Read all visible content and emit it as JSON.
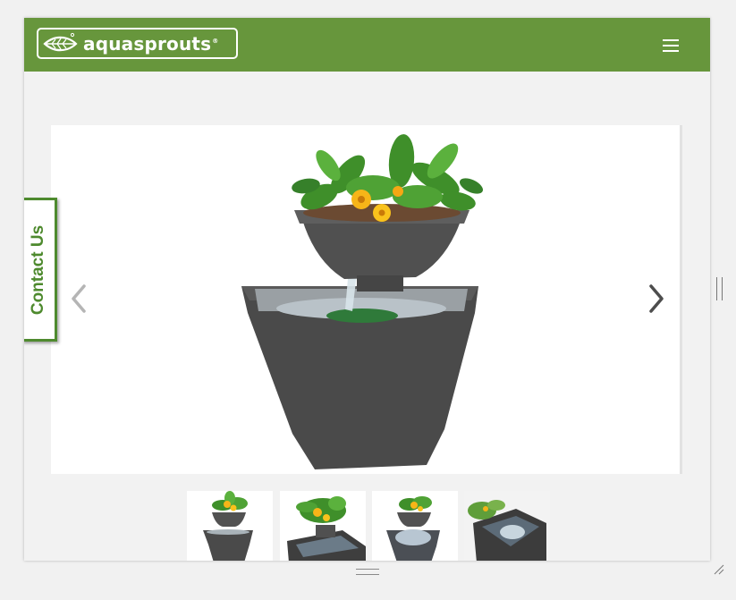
{
  "header": {
    "logo_text": "aquasprouts",
    "logo_reg": "®",
    "menu_icon": "hamburger-menu-icon"
  },
  "slider": {
    "image_alt": "AquaSprouts tiered planter fountain with flowers and greens",
    "prev_icon": "chevron-left-icon",
    "next_icon": "chevron-right-icon"
  },
  "contact_tab": {
    "label": "Contact Us"
  },
  "thumbnails": [
    {
      "alt": "Planter fountain front view"
    },
    {
      "alt": "Planter fountain angled top view"
    },
    {
      "alt": "Planter fountain with water glow"
    },
    {
      "alt": "Planter fountain close-up of lower basin"
    }
  ],
  "colors": {
    "header_bg": "#67963c",
    "contact_green": "#4e8a2e",
    "pot_gray": "#4a4a4a",
    "page_bg": "#f2f2f2"
  }
}
